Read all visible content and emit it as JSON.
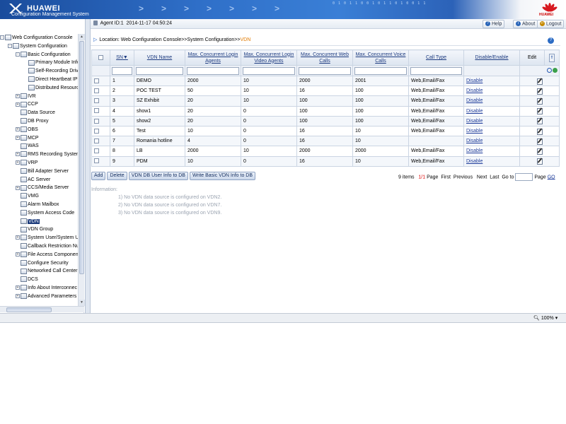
{
  "header": {
    "brand": "HUAWEI",
    "subtitle": "Configuration Management System",
    "digits": "0 1 0 1 1 0 0 1 0 1 1 0 1 0 0 1 1",
    "logo_word": "HUAWEI"
  },
  "infobar": {
    "agent_label": "Agent ID:1",
    "datetime": "2014-11-17 04:50:24",
    "help": "Help",
    "about": "About",
    "logout": "Logout"
  },
  "tree": [
    {
      "label": "Web Configuration Console",
      "level": 0,
      "exp": "-",
      "icon": "console-icon"
    },
    {
      "label": "System Configuration",
      "level": 1,
      "exp": "-",
      "icon": "folder-icon"
    },
    {
      "label": "Basic Configuration",
      "level": 2,
      "exp": "-",
      "icon": "folder-icon"
    },
    {
      "label": "Primary Module Info",
      "level": 3,
      "exp": "",
      "icon": "gear-icon"
    },
    {
      "label": "Self-Recording Drive",
      "level": 3,
      "exp": "",
      "icon": "gear-icon"
    },
    {
      "label": "Direct Heartbeat IP",
      "level": 3,
      "exp": "",
      "icon": "gear-icon"
    },
    {
      "label": "Distributed Resource",
      "level": 3,
      "exp": "",
      "icon": "gear-icon"
    },
    {
      "label": "IVR",
      "level": 2,
      "exp": "+",
      "icon": "gear-icon"
    },
    {
      "label": "CCP",
      "level": 2,
      "exp": "+",
      "icon": "gear-icon"
    },
    {
      "label": "Data Source",
      "level": 2,
      "exp": "",
      "icon": "gear-icon"
    },
    {
      "label": "DB Proxy",
      "level": 2,
      "exp": "",
      "icon": "gear-icon"
    },
    {
      "label": "OBS",
      "level": 2,
      "exp": "+",
      "icon": "gear-icon"
    },
    {
      "label": "MCP",
      "level": 2,
      "exp": "+",
      "icon": "gear-icon"
    },
    {
      "label": "WAS",
      "level": 2,
      "exp": "",
      "icon": "gear-icon"
    },
    {
      "label": "RMS Recording System",
      "level": 2,
      "exp": "+",
      "icon": "gear-icon"
    },
    {
      "label": "VRP",
      "level": 2,
      "exp": "+",
      "icon": "gear-icon"
    },
    {
      "label": "Bill Adapter Server",
      "level": 2,
      "exp": "",
      "icon": "gear-icon"
    },
    {
      "label": "AC Server",
      "level": 2,
      "exp": "",
      "icon": "gear-icon"
    },
    {
      "label": "CCS/Media Server",
      "level": 2,
      "exp": "+",
      "icon": "gear-icon"
    },
    {
      "label": "VMG",
      "level": 2,
      "exp": "",
      "icon": "gear-icon"
    },
    {
      "label": "Alarm Mailbox",
      "level": 2,
      "exp": "",
      "icon": "gear-icon"
    },
    {
      "label": "System Access Code",
      "level": 2,
      "exp": "",
      "icon": "gear-icon"
    },
    {
      "label": "VDN",
      "level": 2,
      "exp": "",
      "icon": "gear-icon",
      "selected": true
    },
    {
      "label": "VDN Group",
      "level": 2,
      "exp": "",
      "icon": "gear-icon"
    },
    {
      "label": "System User/System Us",
      "level": 2,
      "exp": "+",
      "icon": "gear-icon"
    },
    {
      "label": "Callback Restriction Num",
      "level": 2,
      "exp": "",
      "icon": "gear-icon"
    },
    {
      "label": "File Access Component",
      "level": 2,
      "exp": "+",
      "icon": "gear-icon"
    },
    {
      "label": "Configure Security",
      "level": 2,
      "exp": "",
      "icon": "gear-icon"
    },
    {
      "label": "Networked Call Center",
      "level": 2,
      "exp": "",
      "icon": "gear-icon"
    },
    {
      "label": "DCS",
      "level": 2,
      "exp": "",
      "icon": "gear-icon"
    },
    {
      "label": "Info About Interconnec",
      "level": 2,
      "exp": "+",
      "icon": "gear-icon"
    },
    {
      "label": "Advanced Parameters",
      "level": 2,
      "exp": "+",
      "icon": "gear-icon"
    }
  ],
  "breadcrumb": {
    "prefix": "Location: Web Configuration Console>>System Configuration>>",
    "current": "VDN"
  },
  "table": {
    "headers": [
      "SN",
      "VDN Name",
      "Max. Concurrent Login Agents",
      "Max. Concurrent Login Video Agents",
      "Max. Concurrent Web Calls",
      "Max. Concurrent Voice Calls",
      "Call Type",
      "Disable/Enable",
      "Edit"
    ],
    "rows": [
      {
        "sn": "1",
        "name": "DEMO",
        "agents": "2000",
        "video": "10",
        "web": "2000",
        "voice": "2001",
        "type": "Web,Email/Fax",
        "action": "Disable"
      },
      {
        "sn": "2",
        "name": "POC TEST",
        "agents": "50",
        "video": "10",
        "web": "16",
        "voice": "100",
        "type": "Web,Email/Fax",
        "action": "Disable"
      },
      {
        "sn": "3",
        "name": "SZ Exhibit",
        "agents": "20",
        "video": "10",
        "web": "100",
        "voice": "100",
        "type": "Web,Email/Fax",
        "action": "Disable"
      },
      {
        "sn": "4",
        "name": "show1",
        "agents": "20",
        "video": "0",
        "web": "100",
        "voice": "100",
        "type": "Web,Email/Fax",
        "action": "Disable"
      },
      {
        "sn": "5",
        "name": "show2",
        "agents": "20",
        "video": "0",
        "web": "100",
        "voice": "100",
        "type": "Web,Email/Fax",
        "action": "Disable"
      },
      {
        "sn": "6",
        "name": "Test",
        "agents": "10",
        "video": "0",
        "web": "16",
        "voice": "10",
        "type": "Web,Email/Fax",
        "action": "Disable"
      },
      {
        "sn": "7",
        "name": "Romania hotline",
        "agents": "4",
        "video": "0",
        "web": "16",
        "voice": "10",
        "type": "",
        "action": "Disable"
      },
      {
        "sn": "8",
        "name": "LB",
        "agents": "2000",
        "video": "10",
        "web": "2000",
        "voice": "2000",
        "type": "Web,Email/Fax",
        "action": "Disable"
      },
      {
        "sn": "9",
        "name": "PDM",
        "agents": "10",
        "video": "0",
        "web": "16",
        "voice": "10",
        "type": "Web,Email/Fax",
        "action": "Disable"
      }
    ]
  },
  "actions": {
    "add": "Add",
    "delete": "Delete",
    "user_info": "VDN DB User Info to DB",
    "basic_info": "Write Basic VDN Info to DB"
  },
  "pager": {
    "items": "9 items",
    "page_current": "1/1",
    "page_word": "Page",
    "first": "First",
    "previous": "Previous",
    "next": "Next",
    "last": "Last",
    "goto": "Go to",
    "page_label": "Page",
    "go": "GO"
  },
  "information": {
    "title": "Information:",
    "lines": [
      "1) No VDN data source is configured on VDN2.",
      "2) No VDN data source is configured on VDN7.",
      "3) No VDN data source is configured on VDN9."
    ]
  },
  "statusbar": {
    "zoom": "100%"
  },
  "colors": {
    "accent": "#1d3b9a",
    "current": "#e07a00",
    "banner": "#2f6fc8"
  }
}
